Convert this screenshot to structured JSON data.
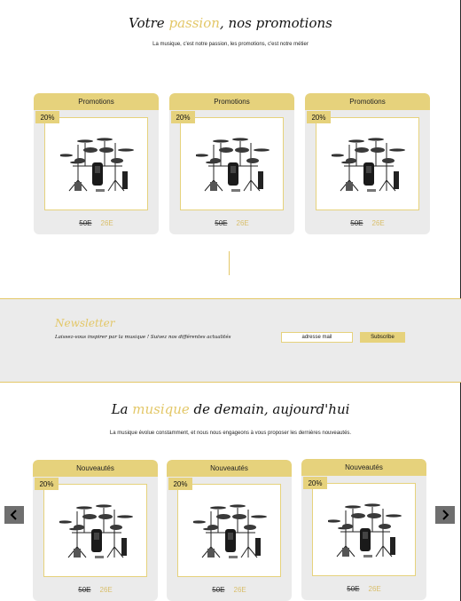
{
  "promotions": {
    "title_before": "Votre ",
    "title_accent": "passion",
    "title_after": ", nos promotions",
    "subtitle": "La musique, c'est notre passion, les promotions, c'est notre métier",
    "cards": [
      {
        "header": "Promotions",
        "badge": "20%",
        "old_price": "50E",
        "new_price": "26E"
      },
      {
        "header": "Promotions",
        "badge": "20%",
        "old_price": "50E",
        "new_price": "26E"
      },
      {
        "header": "Promotions",
        "badge": "20%",
        "old_price": "50E",
        "new_price": "26E"
      }
    ]
  },
  "newsletter": {
    "title": "Newsletter",
    "text": "Laissez-vous inspirer par la musique ! Suivez nos différentes actualités",
    "input_value": "adresse mail",
    "button": "Subscribe"
  },
  "news": {
    "title_before": "La ",
    "title_accent": "musique",
    "title_after": " de demain, aujourd'hui",
    "subtitle": "La musique évolue constamment, et nous nous engageons à vous proposer les dernières nouveautés.",
    "cards": [
      {
        "header": "Nouveautés",
        "badge": "20%",
        "old_price": "50E",
        "new_price": "26E"
      },
      {
        "header": "Nouveautés",
        "badge": "20%",
        "old_price": "50E",
        "new_price": "26E"
      },
      {
        "header": "Nouveautés",
        "badge": "20%",
        "old_price": "50E",
        "new_price": "26E"
      }
    ],
    "prev_icon": "chevron-left-icon",
    "next_icon": "chevron-right-icon"
  },
  "colors": {
    "accent": "#e6d27c",
    "card_bg": "#ebebeb",
    "arrow_bg": "#6f6f6f"
  }
}
